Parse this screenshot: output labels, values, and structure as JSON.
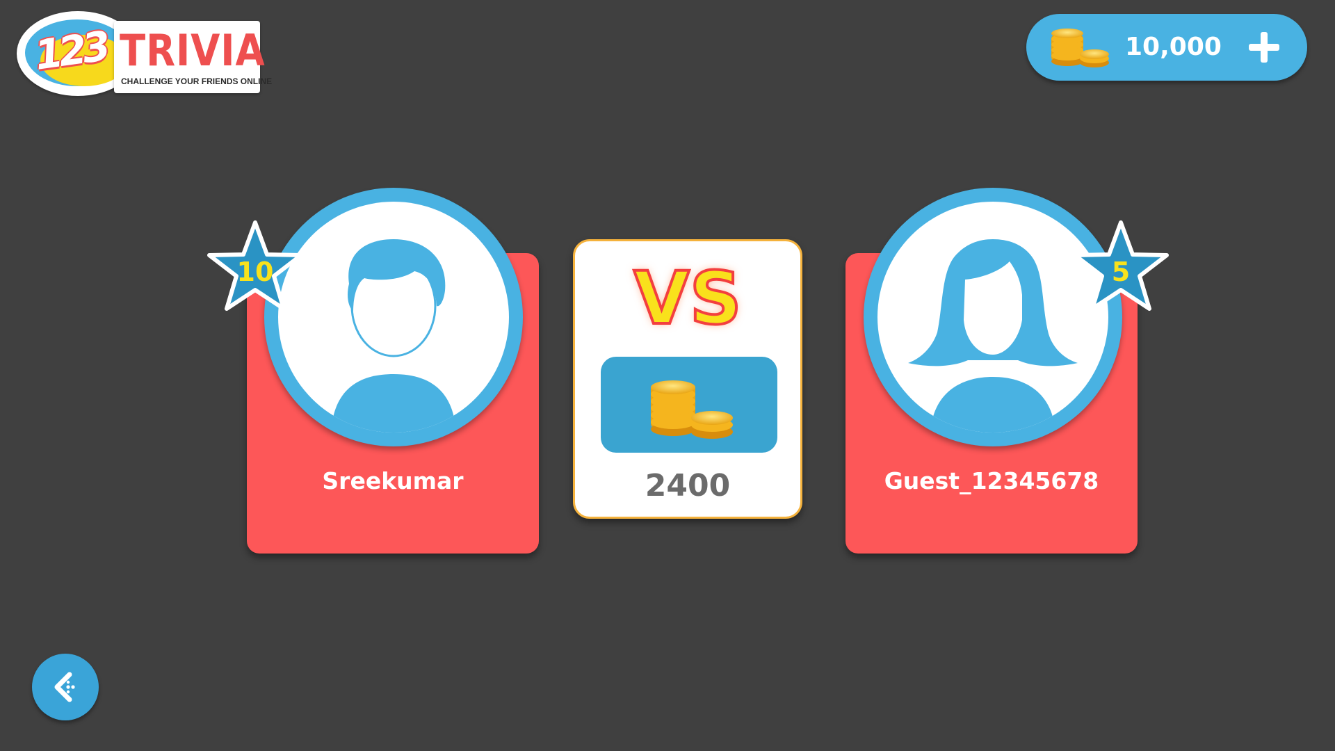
{
  "logo": {
    "digits": "123",
    "word": "TRIVIA",
    "tagline": "CHALLENGE YOUR FRIENDS ONLINE"
  },
  "wallet": {
    "coins": "10,000",
    "coins_icon": "coin-stack-icon",
    "add_icon": "plus-icon"
  },
  "players": {
    "left": {
      "name": "Sreekumar",
      "level": "10",
      "avatar": "male-avatar-icon"
    },
    "right": {
      "name": "Guest_12345678",
      "level": "5",
      "avatar": "female-avatar-icon"
    }
  },
  "match": {
    "vs_label": "VS",
    "stake": "2400",
    "stake_icon": "coin-stack-icon"
  },
  "navigation": {
    "back_icon": "back-arrow-icon"
  },
  "colors": {
    "background": "#404040",
    "card_red": "#fd5758",
    "accent_blue": "#49b2e2",
    "star_yellow": "#f9e21c",
    "vs_red": "#f33f3f",
    "vs_border": "#f5b23c"
  }
}
